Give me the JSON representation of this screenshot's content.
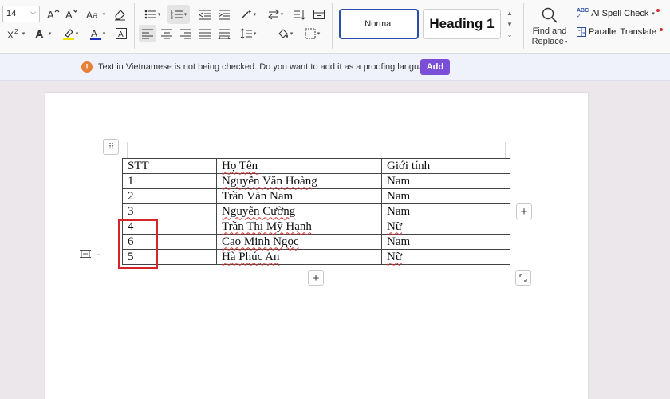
{
  "ribbon": {
    "font_size": "14",
    "styles": {
      "normal": "Normal",
      "heading1": "Heading 1"
    },
    "find_replace": {
      "line1": "Find and",
      "line2": "Replace"
    },
    "ai_spell_check": "AI Spell Check",
    "parallel_translate": "Parallel Translate",
    "icons": [
      "font-grow-icon",
      "font-shrink-icon",
      "change-case-icon",
      "clear-format-icon",
      "bullets-icon",
      "numbering-icon",
      "decrease-indent-icon",
      "increase-indent-icon",
      "magic-format-icon",
      "text-direction-icon",
      "sort-icon",
      "show-marks-icon",
      "superscript-icon",
      "highlight-icon",
      "font-color-icon",
      "char-border-icon",
      "align-left-icon",
      "align-center-icon",
      "align-right-icon",
      "justify-icon",
      "distributed-icon",
      "line-spacing-icon",
      "shading-icon",
      "borders-icon",
      "search-icon"
    ],
    "accent_color": "#2b4fa8"
  },
  "message_bar": {
    "text": "Text in Vietnamese is not being checked. Do you want to add it as a proofing language?",
    "add_label": "Add",
    "icon_glyph": "!",
    "warning_color": "#e8803a",
    "button_color": "#7a4ed8"
  },
  "table_handle_glyph": "⠿",
  "table": {
    "headers": [
      "STT",
      "Họ Tên",
      "Giới tính"
    ],
    "rows": [
      [
        "1",
        "Nguyễn Văn Hoàng",
        "Nam"
      ],
      [
        "2",
        "Trần Văn Nam",
        "Nam"
      ],
      [
        "3",
        "Nguyễn Cường",
        "Nam"
      ],
      [
        "4",
        "Trần Thị Mỹ Hạnh",
        "Nữ"
      ],
      [
        "6",
        "Cao Minh Ngọc",
        "Nam"
      ],
      [
        "5",
        "Hà Phúc An",
        "Nữ"
      ]
    ],
    "highlight_color": "#d42626"
  },
  "controls": {
    "add_row": "+",
    "add_column": "+"
  }
}
